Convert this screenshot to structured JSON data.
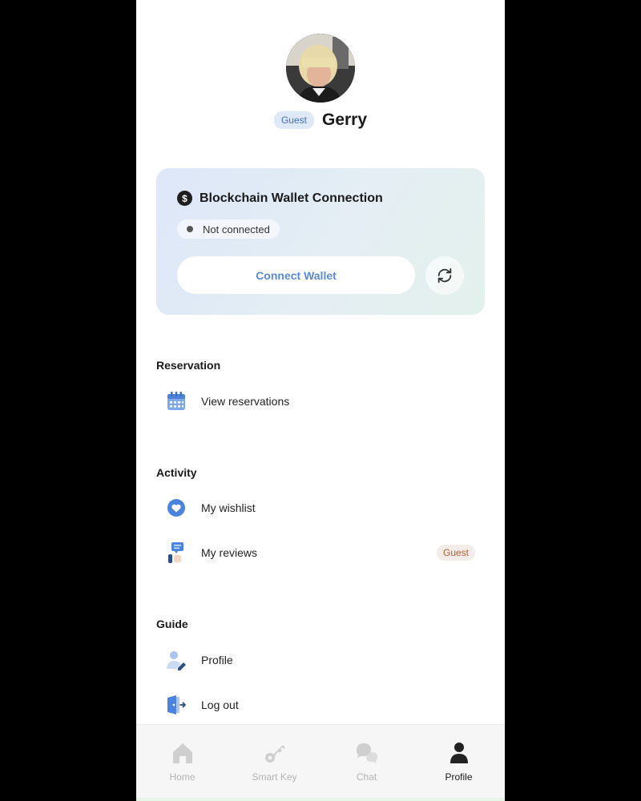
{
  "profile": {
    "role_badge": "Guest",
    "name": "Gerry"
  },
  "wallet": {
    "title": "Blockchain Wallet Connection",
    "status": "Not connected",
    "connect_label": "Connect Wallet",
    "icon": "dollar-icon",
    "refresh_icon": "refresh-icon"
  },
  "sections": {
    "reservation": {
      "title": "Reservation",
      "items": [
        {
          "label": "View reservations",
          "icon": "calendar-icon"
        }
      ]
    },
    "activity": {
      "title": "Activity",
      "items": [
        {
          "label": "My wishlist",
          "icon": "heart-icon"
        },
        {
          "label": "My reviews",
          "icon": "reviews-icon",
          "badge": "Guest"
        }
      ]
    },
    "guide": {
      "title": "Guide",
      "items": [
        {
          "label": "Profile",
          "icon": "profile-edit-icon"
        },
        {
          "label": "Log out",
          "icon": "logout-icon"
        }
      ]
    }
  },
  "bottom_nav": {
    "items": [
      {
        "label": "Home",
        "icon": "home-icon",
        "active": false
      },
      {
        "label": "Smart Key",
        "icon": "key-icon",
        "active": false
      },
      {
        "label": "Chat",
        "icon": "chat-icon",
        "active": false
      },
      {
        "label": "Profile",
        "icon": "person-icon",
        "active": true
      }
    ]
  },
  "colors": {
    "accent": "#5a8ad6",
    "guest_badge_text": "#3f6fbf",
    "review_badge_text": "#b5623a"
  }
}
